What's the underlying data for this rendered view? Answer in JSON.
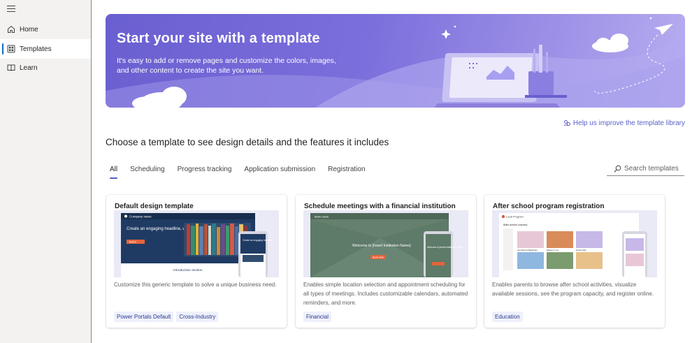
{
  "sidebar": {
    "items": [
      {
        "label": "Home",
        "icon": "home-icon",
        "active": false
      },
      {
        "label": "Templates",
        "icon": "templates-icon",
        "active": true
      },
      {
        "label": "Learn",
        "icon": "book-icon",
        "active": false
      }
    ]
  },
  "hero": {
    "title": "Start your site with a template",
    "subtitle": "It's easy to add or remove pages and customize the colors, images, and other content to create the site you want."
  },
  "help_link": "Help us improve the template library",
  "section_title": "Choose a template to see design details and the features it includes",
  "tabs": [
    "All",
    "Scheduling",
    "Progress tracking",
    "Application submission",
    "Registration"
  ],
  "active_tab": "All",
  "search": {
    "placeholder": "Search templates"
  },
  "cards": [
    {
      "title": "Default design template",
      "description": "Customize this generic template to solve a unique business need.",
      "tags": [
        "Power Portals Default",
        "Cross-Industry"
      ],
      "thumb": {
        "brand": "Company name",
        "headline": "Create an engaging headline, welcome, or call to action",
        "cta": "Button",
        "section": "Introduction section",
        "phone_headline": "Create an engaging headline"
      }
    },
    {
      "title": "Schedule meetings with a financial institution",
      "description": "Enables simple location selection and appointment scheduling for all types of meetings. Includes customizable calendars, automated reminders, and more.",
      "tags": [
        "Financial"
      ],
      "thumb": {
        "brand": "Bank name",
        "headline": "Welcome to [Insert Institution Name]",
        "cta": "Book Now",
        "phone_headline": "Welcome to [Insert Institution Name]"
      }
    },
    {
      "title": "After school program registration",
      "description": "Enables parents to browse after school activities, visualize available sessions, see the program capacity, and register online.",
      "tags": [
        "Education"
      ],
      "thumb": {
        "brand": "Local Program",
        "heading": "After school courses",
        "tiles": [
          "Art Class for Beginners",
          "Parkour 1 o.a",
          "Tennis Club"
        ]
      }
    }
  ],
  "colors": {
    "accent": "#5b5fc7",
    "hero_start": "#6a5fd0",
    "hero_end": "#b7adf0",
    "active_nav": "#0f6cbd"
  }
}
